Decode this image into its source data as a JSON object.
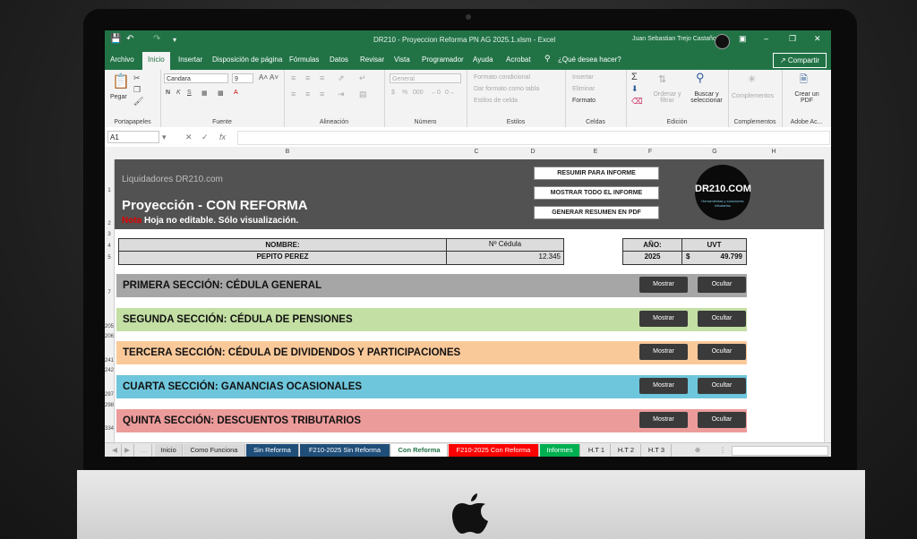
{
  "window": {
    "title": "DR210 - Proyeccion Reforma PN AG 2025.1.xlsm  -  Excel",
    "user": "Juan Sebastian Trejo Castaño"
  },
  "menu": {
    "tabs": [
      "Archivo",
      "Inicio",
      "Insertar",
      "Disposición de página",
      "Fórmulas",
      "Datos",
      "Revisar",
      "Vista",
      "Programador",
      "Ayuda",
      "Acrobat"
    ],
    "tell_me": "¿Qué desea hacer?",
    "share": "Compartir"
  },
  "ribbon": {
    "clipboard": {
      "paste": "Pegar",
      "label": "Portapapeles"
    },
    "font": {
      "name": "Candara",
      "size": "9",
      "bold": "N",
      "italic": "K",
      "underline": "S",
      "label": "Fuente"
    },
    "alignment": {
      "label": "Alineación"
    },
    "number": {
      "format": "General",
      "label": "Número"
    },
    "styles": {
      "conditional": "Formato condicional",
      "as_table": "Dar formato como tabla",
      "cell_styles": "Estilos de celda",
      "label": "Estilos"
    },
    "cells": {
      "insert": "Insertar",
      "delete": "Eliminar",
      "format": "Formato",
      "label": "Celdas"
    },
    "editing": {
      "sort": "Ordenar y filtrar",
      "find": "Buscar y seleccionar",
      "label": "Edición"
    },
    "addins": {
      "name": "Complementos",
      "label": "Complementos"
    },
    "adobe": {
      "name": "Crear un PDF",
      "label": "Adobe Ac..."
    }
  },
  "formula_bar": {
    "cell": "A1",
    "fx": "fx",
    "value": ""
  },
  "columns": [
    "B",
    "C",
    "D",
    "E",
    "F",
    "G",
    "H"
  ],
  "rows": [
    "1",
    "2",
    "3",
    "4",
    "5",
    "7",
    "205",
    "206",
    "241",
    "242",
    "297",
    "298",
    "334"
  ],
  "sheet": {
    "brand": "Liquidadores DR210.com",
    "title": "Proyección - CON REFORMA",
    "note_label": "Nota",
    "note_text": " Hoja no editable. Sólo visualización.",
    "buttons": [
      "RESUMIR PARA INFORME",
      "MOSTRAR TODO EL INFORME",
      "GENERAR RESUMEN EN PDF"
    ],
    "logo": {
      "name": "DR210.COM",
      "tagline": "Herramientas y soluciones tributarias"
    },
    "info": {
      "name_header": "NOMBRE:",
      "name_value": "PEPITO PEREZ",
      "id_header": "Nº Cédula",
      "id_value": "12.345",
      "year_header": "AÑO:",
      "year_value": "2025",
      "uvt_header": "UVT",
      "uvt_currency": "$",
      "uvt_value": "49.799"
    },
    "sections": [
      {
        "title": "PRIMERA SECCIÓN: CÉDULA GENERAL",
        "color": "#a6a6a6"
      },
      {
        "title": "SEGUNDA SECCIÓN: CÉDULA DE PENSIONES",
        "color": "#c3dfa4"
      },
      {
        "title": "TERCERA SECCIÓN: CÉDULA DE DIVIDENDOS Y PARTICIPACIONES",
        "color": "#fac99a"
      },
      {
        "title": "CUARTA SECCIÓN: GANANCIAS OCASIONALES",
        "color": "#6ec6dc"
      },
      {
        "title": "QUINTA SECCIÓN: DESCUENTOS TRIBUTARIOS",
        "color": "#ec9b9b"
      }
    ],
    "show_label": "Mostrar",
    "hide_label": "Ocultar"
  },
  "sheet_tabs": [
    {
      "label": "Inicio",
      "color": "#d9d9d9"
    },
    {
      "label": "Como Funciona",
      "color": "#d9d9d9"
    },
    {
      "label": "Sin Reforma",
      "color": "#1f4e79"
    },
    {
      "label": "F210-2025 Sin Reforma",
      "color": "#1f4e79"
    },
    {
      "label": "Con Reforma",
      "color": "#ffffff"
    },
    {
      "label": "F210-2025 Con Reforma",
      "color": "#ff0000"
    },
    {
      "label": "Informes",
      "color": "#00b050"
    },
    {
      "label": "H.T 1",
      "color": "#e6e6e6"
    },
    {
      "label": "H.T 2",
      "color": "#e6e6e6"
    },
    {
      "label": "H.T 3",
      "color": "#e6e6e6"
    }
  ]
}
